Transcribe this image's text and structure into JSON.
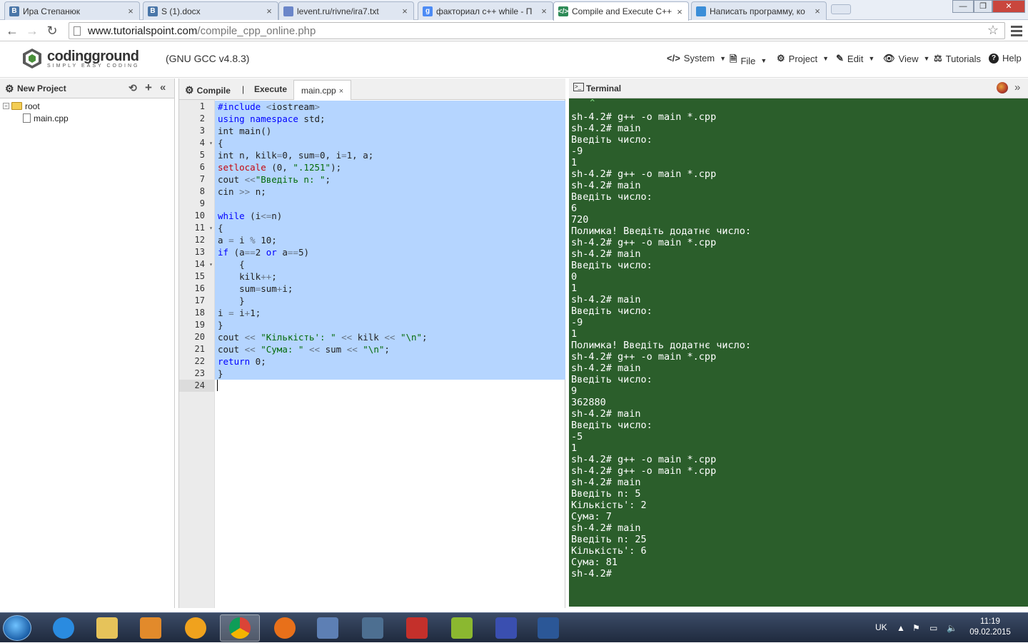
{
  "browser": {
    "tabs": [
      {
        "title": "Ира Степанюк",
        "icon": "vk-icon",
        "favicon_letter": "В",
        "color": "#4a76a8"
      },
      {
        "title": "S (1).docx",
        "icon": "vk-icon",
        "favicon_letter": "В",
        "color": "#4a76a8"
      },
      {
        "title": "levent.ru/rivne/ira7.txt",
        "icon": "document-icon",
        "favicon_letter": "",
        "color": "#6b86c9"
      },
      {
        "title": "факториал c++ while - П",
        "icon": "google-icon",
        "favicon_letter": "g",
        "color": "#4c8bf5"
      },
      {
        "title": "Compile and Execute C++",
        "icon": "tutorialspoint-icon",
        "favicon_letter": "</>",
        "color": "#2e8b57"
      },
      {
        "title": "Написать программу, ко",
        "icon": "people-icon",
        "favicon_letter": "",
        "color": "#3b8ed8"
      }
    ],
    "active_tab": 4,
    "url_host": "www.tutorialspoint.com",
    "url_path": "/compile_cpp_online.php",
    "window_buttons": {
      "minimize": "—",
      "maximize": "❐",
      "close": "✕"
    }
  },
  "site": {
    "logo_name": "codingground",
    "logo_tagline": "SIMPLY EASY CODING",
    "compiler_version": "(GNU GCC v4.8.3)",
    "menu": [
      {
        "label": "System",
        "icon": "code-icon",
        "glyph": "</>",
        "dropdown": true
      },
      {
        "label": "File",
        "icon": "file-icon",
        "glyph": "🗎",
        "dropdown": true
      },
      {
        "label": "Project",
        "icon": "gear-icon",
        "glyph": "⚙",
        "dropdown": true
      },
      {
        "label": "Edit",
        "icon": "edit-icon",
        "glyph": "✎",
        "dropdown": true
      },
      {
        "label": "View",
        "icon": "eye-icon",
        "glyph": "👁",
        "dropdown": true
      },
      {
        "label": "Tutorials",
        "icon": "tutorials-icon",
        "glyph": "⚖",
        "dropdown": false
      },
      {
        "label": "Help",
        "icon": "help-icon",
        "glyph": "?",
        "dropdown": false
      }
    ]
  },
  "project": {
    "new_project_label": "New Project",
    "tree": {
      "root_label": "root",
      "files": [
        "main.cpp"
      ]
    }
  },
  "editor": {
    "compile_label": "Compile",
    "separator": "|",
    "execute_label": "Execute",
    "file_tab": "main.cpp",
    "close_glyph": "×",
    "current_line": 24,
    "fold_lines": [
      4,
      11,
      14
    ],
    "lines": [
      "#include <iostream>",
      "using namespace std;",
      "int main()",
      "{",
      "int n, kilk=0, sum=0, i=1, a;",
      "setlocale (0, \".1251\");",
      "cout <<\"Введіть n: \";",
      "cin >> n;",
      "",
      "while (i<=n)",
      "{",
      "a = i % 10;",
      "if (a==2 or a==5)",
      "    {",
      "    kilk++;",
      "    sum=sum+i;",
      "    }",
      "i = i+1;",
      "}",
      "cout << \"Кількість': \" << kilk << \"\\n\";",
      "cout << \"Сума: \" << sum << \"\\n\";",
      "return 0;",
      "}",
      ""
    ]
  },
  "terminal": {
    "title": "Terminal",
    "lines": [
      "    ^",
      "sh-4.2# g++ -o main *.cpp",
      "sh-4.2# main",
      "Введіть число:",
      "-9",
      "1",
      "sh-4.2# g++ -o main *.cpp",
      "sh-4.2# main",
      "Введіть число:",
      "6",
      "720",
      "Полимка! Введіть додатнє число:",
      "sh-4.2# g++ -o main *.cpp",
      "sh-4.2# main",
      "Введіть число:",
      "0",
      "1",
      "sh-4.2# main",
      "Введіть число:",
      "-9",
      "1",
      "Полимка! Введіть додатнє число:",
      "sh-4.2# g++ -o main *.cpp",
      "sh-4.2# main",
      "Введіть число:",
      "9",
      "362880",
      "sh-4.2# main",
      "Введіть число:",
      "-5",
      "1",
      "sh-4.2# g++ -o main *.cpp",
      "sh-4.2# g++ -o main *.cpp",
      "sh-4.2# main",
      "Введіть n: 5",
      "Кількість': 2",
      "Сума: 7",
      "sh-4.2# main",
      "Введіть n: 25",
      "Кількість': 6",
      "Сума: 81",
      "sh-4.2#"
    ],
    "background": "#2b5e2b"
  },
  "taskbar": {
    "apps": [
      {
        "name": "internet-explorer-icon",
        "color": "#2a8be0"
      },
      {
        "name": "file-explorer-icon",
        "color": "#e6c35a"
      },
      {
        "name": "media-player-icon",
        "color": "#e28a2b"
      },
      {
        "name": "avast-icon",
        "color": "#f0a21d"
      },
      {
        "name": "chrome-icon",
        "color": "#d94a38",
        "active": true
      },
      {
        "name": "firefox-icon",
        "color": "#e8701a"
      },
      {
        "name": "virtualbox-icon",
        "color": "#5d7fb4"
      },
      {
        "name": "m-app-icon",
        "color": "#4d6f91"
      },
      {
        "name": "calendar-app-icon",
        "color": "#c4302b"
      },
      {
        "name": "mail-app-icon",
        "color": "#8bb830"
      },
      {
        "name": "floppy-save-icon",
        "color": "#3a4fb0"
      },
      {
        "name": "word-icon",
        "color": "#2b5797"
      }
    ],
    "language": "UK",
    "time": "11:19",
    "date": "09.02.2015"
  }
}
